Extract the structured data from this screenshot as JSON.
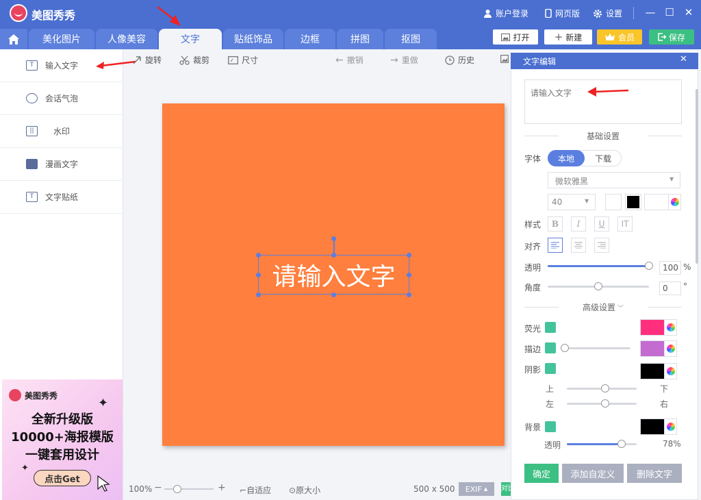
{
  "app": {
    "title": "美图秀秀"
  },
  "titlebar": {
    "account": "账户登录",
    "web": "网页版",
    "settings": "设置"
  },
  "tabs": [
    "美化图片",
    "人像美容",
    "文字",
    "贴纸饰品",
    "边框",
    "拼图",
    "抠图"
  ],
  "header_buttons": {
    "open": "打开",
    "new": "新建",
    "member": "会员",
    "save": "保存"
  },
  "left_menu": [
    "输入文字",
    "会话气泡",
    "水印",
    "漫画文字",
    "文字贴纸"
  ],
  "ad": {
    "brand": "美图秀秀",
    "line1": "全新升级版",
    "line2": "10000+海报模版",
    "line3": "一键套用设计",
    "button": "点击Get"
  },
  "toolbar": {
    "rotate": "旋转",
    "crop": "裁剪",
    "size": "尺寸",
    "undo": "撤销",
    "redo": "重做",
    "history": "历史"
  },
  "canvas": {
    "text": "请输入文字",
    "color": "#fe7f3e"
  },
  "bottom": {
    "zoom": "100%",
    "fit": "自适应",
    "original": "原大小",
    "dimensions": "500 x 500",
    "exif": "EXIF",
    "compare": "对比"
  },
  "panel": {
    "title": "文字编辑",
    "input_placeholder": "请输入文字",
    "basic_settings": "基础设置",
    "font_label": "字体",
    "font_tab_local": "本地",
    "font_tab_download": "下载",
    "font_name": "微软雅黑",
    "font_size": "40",
    "style_label": "样式",
    "style_bold": "B",
    "style_italic": "I",
    "style_underline": "U",
    "style_vertical": "IT",
    "align_label": "对齐",
    "opacity_label": "透明",
    "opacity_value": "100",
    "opacity_unit": "%",
    "angle_label": "角度",
    "angle_value": "0",
    "angle_unit": "°",
    "advanced_settings": "高级设置",
    "glow_label": "荧光",
    "stroke_label": "描边",
    "shadow_label": "阴影",
    "shadow_up": "上",
    "shadow_down": "下",
    "shadow_left": "左",
    "shadow_right": "右",
    "background_label": "背景",
    "bg_opacity_label": "透明",
    "bg_opacity_value": "78%",
    "confirm": "确定",
    "add_custom": "添加自定义",
    "delete_text": "删除文字"
  },
  "levels": {
    "opacity": 1.0,
    "angle": 0.5,
    "stroke": 0.05,
    "shadow_vertical": 0.55,
    "shadow_horizontal": 0.55,
    "bg_opacity": 0.78
  },
  "colors": {
    "glow": "#ff2f7e",
    "stroke": "#c46bd1",
    "shadow": "#000000",
    "background": "#000000",
    "text": "#000000",
    "accent": "#4a6fd1"
  }
}
